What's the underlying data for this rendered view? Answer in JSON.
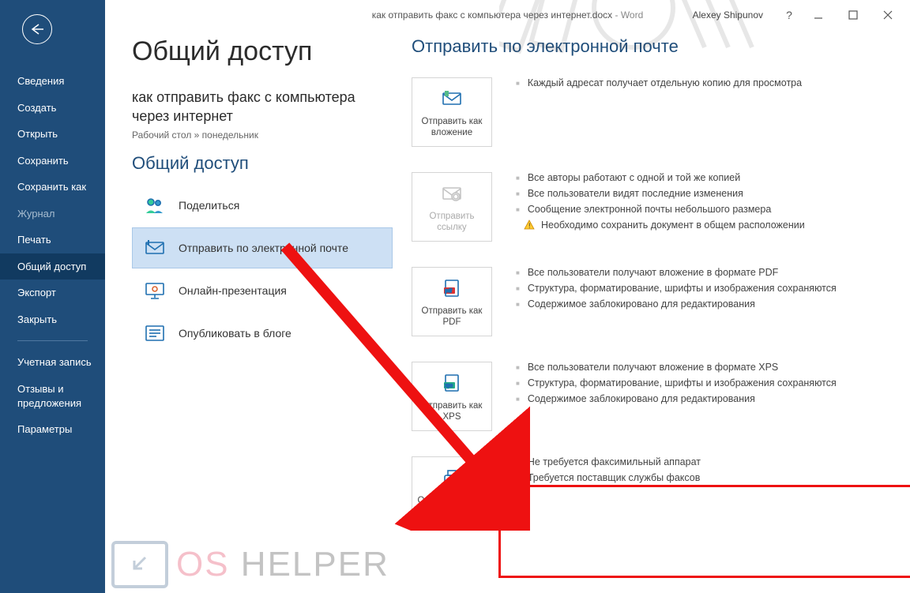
{
  "titlebar": {
    "doc_title": "как отправить факс с компьютера через интернет.docx",
    "app_suffix": " - Word",
    "user": "Alexey Shipunov"
  },
  "sidebar": {
    "items": [
      {
        "label": "Сведения",
        "sel": false,
        "dim": false
      },
      {
        "label": "Создать",
        "sel": false,
        "dim": false
      },
      {
        "label": "Открыть",
        "sel": false,
        "dim": false
      },
      {
        "label": "Сохранить",
        "sel": false,
        "dim": false
      },
      {
        "label": "Сохранить как",
        "sel": false,
        "dim": false
      },
      {
        "label": "Журнал",
        "sel": false,
        "dim": true
      },
      {
        "label": "Печать",
        "sel": false,
        "dim": false
      },
      {
        "label": "Общий доступ",
        "sel": true,
        "dim": false
      },
      {
        "label": "Экспорт",
        "sel": false,
        "dim": false
      },
      {
        "label": "Закрыть",
        "sel": false,
        "dim": false
      }
    ],
    "footer": [
      {
        "label": "Учетная запись"
      },
      {
        "label": "Отзывы и предложения"
      },
      {
        "label": "Параметры"
      }
    ]
  },
  "page": {
    "title": "Общий доступ",
    "doc_name": "как отправить факс с компьютера через интернет",
    "breadcrumb": "Рабочий стол » понедельник",
    "section": "Общий доступ"
  },
  "share_options": [
    {
      "icon": "people-icon",
      "label": "Поделиться"
    },
    {
      "icon": "email-icon",
      "label": "Отправить по электронной почте",
      "sel": true
    },
    {
      "icon": "present-icon",
      "label": "Онлайн-презентация"
    },
    {
      "icon": "blog-icon",
      "label": "Опубликовать в блоге"
    }
  ],
  "right": {
    "title": "Отправить по электронной почте",
    "blocks": [
      {
        "btn": "Отправить как вложение",
        "icon": "envelope-icon",
        "dim": false,
        "bullets": [
          "Каждый адресат получает отдельную копию для просмотра"
        ]
      },
      {
        "btn": "Отправить ссылку",
        "icon": "link-icon",
        "dim": true,
        "bullets": [
          "Все авторы работают с одной и той же копией",
          "Все пользователи видят последние изменения",
          "Сообщение электронной почты небольшого размера"
        ],
        "warn": "Необходимо сохранить документ в общем расположении"
      },
      {
        "btn": "Отправить как PDF",
        "icon": "pdf-icon",
        "dim": false,
        "bullets": [
          "Все пользователи получают вложение в формате PDF",
          "Структура, форматирование, шрифты и изображения сохраняются",
          "Содержимое заблокировано для редактирования"
        ]
      },
      {
        "btn": "Отправить как XPS",
        "icon": "xps-icon",
        "dim": false,
        "bullets": [
          "Все пользователи получают вложение в формате XPS",
          "Структура, форматирование, шрифты и изображения сохраняются",
          "Содержимое заблокировано для редактирования"
        ]
      },
      {
        "btn": "Отправить факс через Интернет",
        "icon": "fax-icon",
        "dim": false,
        "bullets": [
          "Не требуется факсимильный аппарат",
          "Требуется поставщик службы факсов"
        ]
      }
    ]
  },
  "watermark": {
    "os": "OS",
    "helper": " HELPER"
  }
}
